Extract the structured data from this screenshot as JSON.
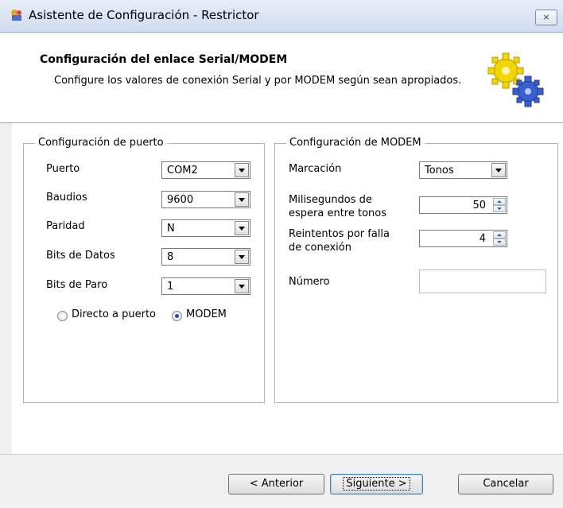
{
  "window": {
    "title": "Asistente de Configuración - Restrictor",
    "close_label": "⨯"
  },
  "header": {
    "title": "Configuración del enlace Serial/MODEM",
    "description": "Configure los valores de conexión Serial y por MODEM según sean apropiados.",
    "icon": "gears-icon"
  },
  "port": {
    "group_label": "Configuración de puerto",
    "fields": [
      {
        "label": "Puerto",
        "value": "COM2"
      },
      {
        "label": "Baudios",
        "value": "9600"
      },
      {
        "label": "Paridad",
        "value": "N"
      },
      {
        "label": "Bits de Datos",
        "value": "8"
      },
      {
        "label": "Bits de Paro",
        "value": "1"
      }
    ],
    "radio_direct": "Directo a puerto",
    "radio_modem": "MODEM",
    "selected": "MODEM"
  },
  "modem": {
    "group_label": "Configuración de MODEM",
    "dial_label": "Marcación",
    "dial_value": "Tonos",
    "wait_label_1": "Milisegundos de",
    "wait_label_2": "espera entre tonos",
    "wait_value": "50",
    "retry_label_1": "Reintentos por falla",
    "retry_label_2": "de conexión",
    "retry_value": "4",
    "number_label": "Número",
    "number_value": ""
  },
  "buttons": {
    "back": "< Anterior",
    "next": "Siguiente >",
    "cancel": "Cancelar"
  },
  "colors": {
    "accent": "#1b4fa8",
    "gear_yellow": "#f2d600",
    "gear_blue": "#3a5fd0"
  }
}
